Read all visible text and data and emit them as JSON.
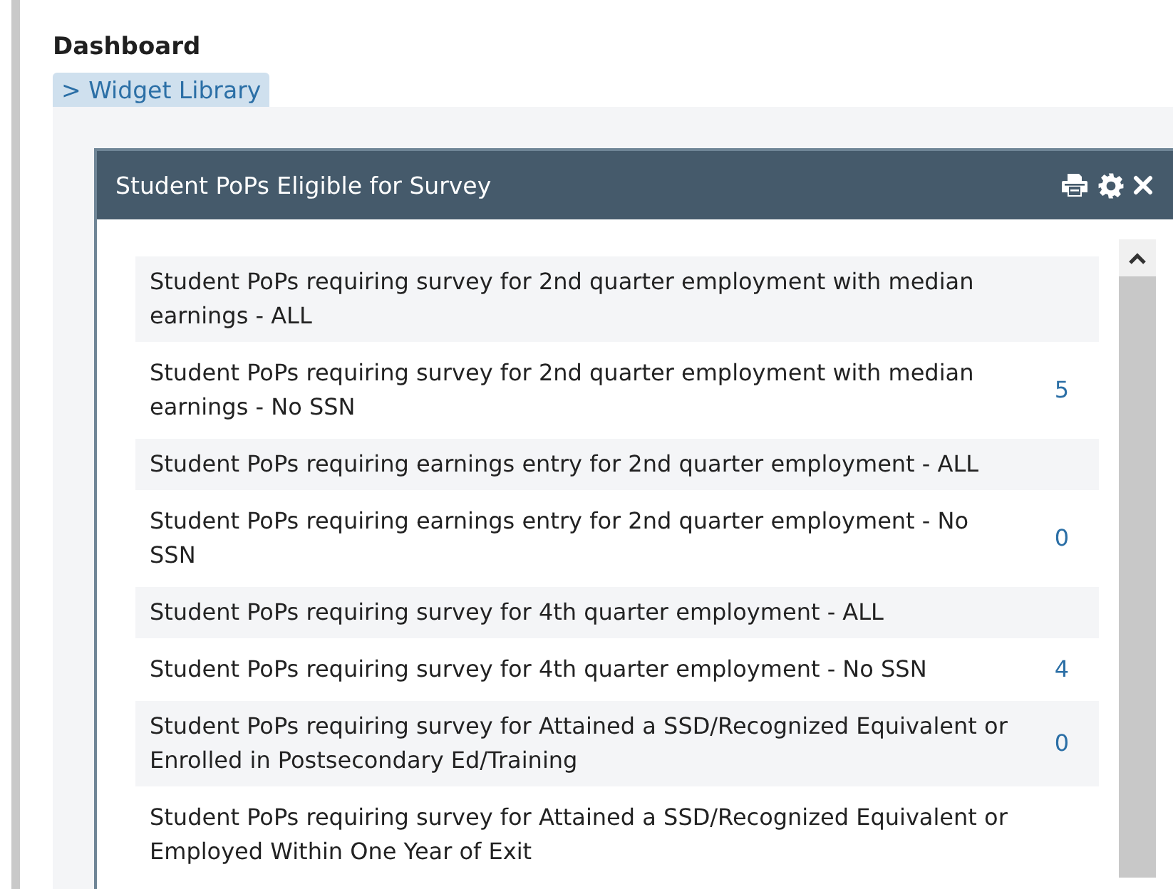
{
  "page_title": "Dashboard",
  "library_link": "> Widget Library",
  "widget": {
    "title": "Student PoPs Eligible for Survey",
    "rows": [
      {
        "label": "Student PoPs requiring survey for 2nd quarter employment with median earnings - ALL"
      },
      {
        "label": "Student PoPs requiring survey for 2nd quarter employment with median earnings - No SSN",
        "count": "5"
      },
      {
        "label": "Student PoPs requiring earnings entry for 2nd quarter employment - ALL"
      },
      {
        "label": "Student PoPs requiring earnings entry for 2nd quarter employment - No SSN",
        "count": "0"
      },
      {
        "label": "Student PoPs requiring survey for 4th quarter employment - ALL"
      },
      {
        "label": "Student PoPs requiring survey for 4th quarter employment - No SSN",
        "count": "4"
      },
      {
        "label": "Student PoPs requiring survey for Attained a SSD/Recognized Equivalent or Enrolled in Postsecondary Ed/Training",
        "count": "0"
      },
      {
        "label": "Student PoPs requiring survey for Attained a SSD/Recognized Equivalent or Employed Within One Year of Exit"
      }
    ]
  }
}
